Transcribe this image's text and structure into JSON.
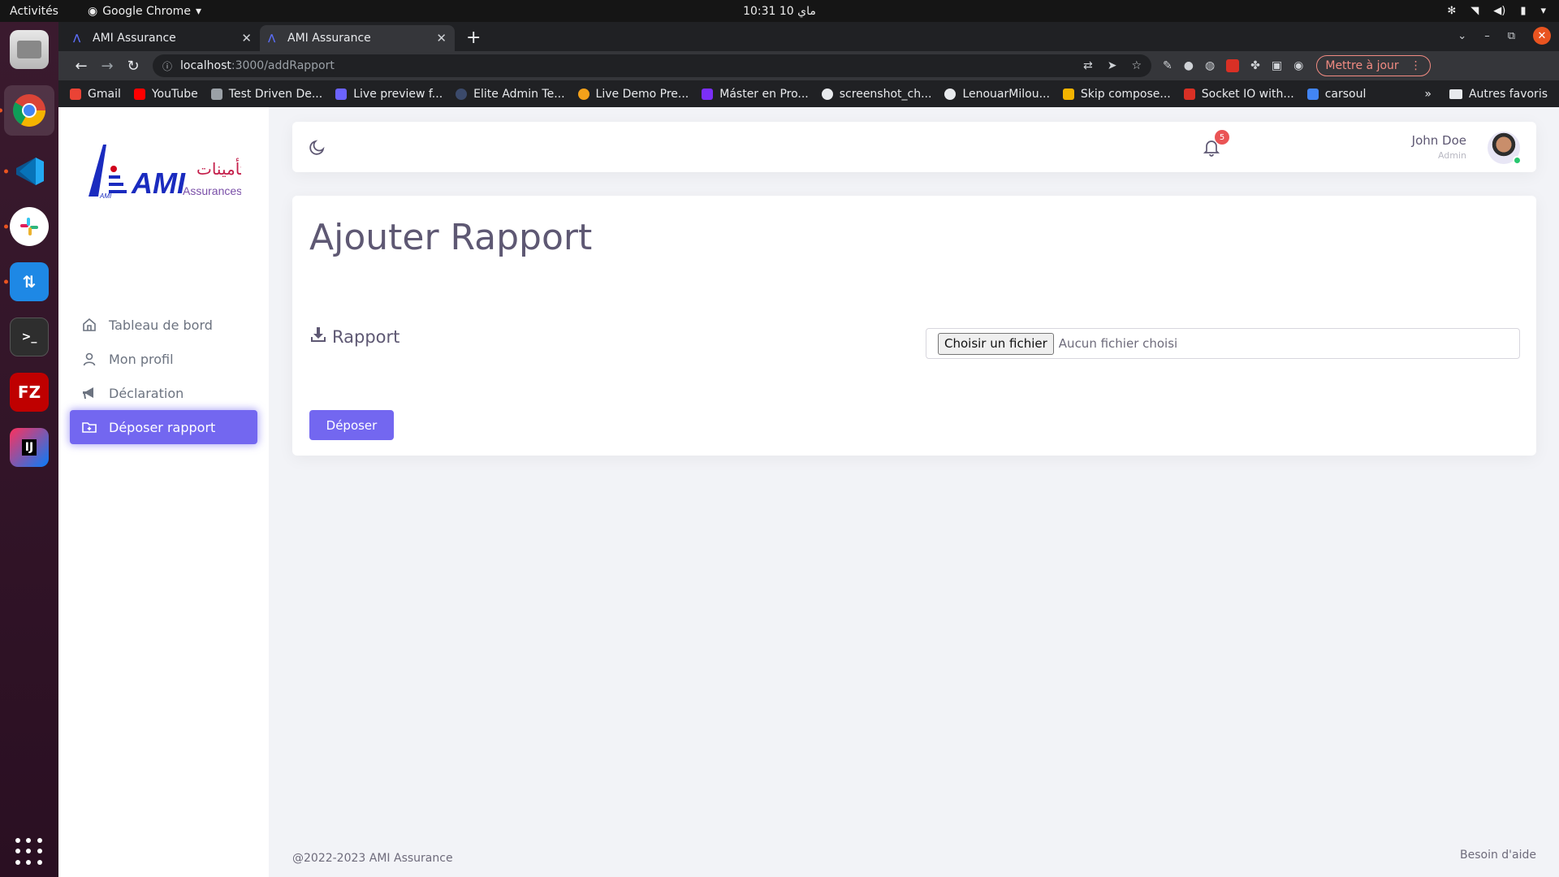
{
  "system_bar": {
    "activities": "Activités",
    "app_name": "Google Chrome",
    "clock": "10:31  ماي 10"
  },
  "browser": {
    "tabs": [
      {
        "title": "AMI Assurance"
      },
      {
        "title": "AMI Assurance"
      }
    ],
    "url_host": "localhost",
    "url_path": ":3000/addRapport",
    "update_label": "Mettre à jour",
    "bookmarks": [
      {
        "label": "Gmail",
        "color": "#ea4335"
      },
      {
        "label": "YouTube",
        "color": "#ff0000"
      },
      {
        "label": "Test Driven De...",
        "color": "#9aa0a6"
      },
      {
        "label": "Live preview f...",
        "color": "#6c63ff"
      },
      {
        "label": "Elite Admin Te...",
        "color": "#3b4a6b"
      },
      {
        "label": "Live Demo Pre...",
        "color": "#f4a11a"
      },
      {
        "label": "Máster en Pro...",
        "color": "#7b2ff7"
      },
      {
        "label": "screenshot_ch...",
        "color": "#e8eaed"
      },
      {
        "label": "LenouarMilou...",
        "color": "#e8eaed"
      },
      {
        "label": "Skip compose...",
        "color": "#f4b400"
      },
      {
        "label": "Socket IO with...",
        "color": "#d93025"
      },
      {
        "label": "carsoul",
        "color": "#4285f4"
      }
    ],
    "more_bookmarks": "»",
    "other_bookmarks": "Autres favoris"
  },
  "brand": {
    "logo_text": "AMI",
    "logo_sub": "Assurances",
    "logo_arabic": "تأمينات",
    "accent_color": "#7367f0"
  },
  "sidebar": {
    "items": [
      {
        "label": "Tableau de bord",
        "icon": "home-icon"
      },
      {
        "label": "Mon profil",
        "icon": "user-icon"
      },
      {
        "label": "Déclaration",
        "icon": "megaphone-icon"
      },
      {
        "label": "Déposer rapport",
        "icon": "folder-plus-icon",
        "active": true
      }
    ]
  },
  "header": {
    "notification_count": "5",
    "user_name": "John Doe",
    "user_role": "Admin"
  },
  "main": {
    "title": "Ajouter Rapport",
    "field_label": "Rapport",
    "file_button": "Choisir un fichier",
    "file_status": "Aucun fichier choisi",
    "submit_label": "Déposer"
  },
  "footer": {
    "copyright": "@2022-2023 AMI Assurance",
    "help": "Besoin d'aide"
  }
}
